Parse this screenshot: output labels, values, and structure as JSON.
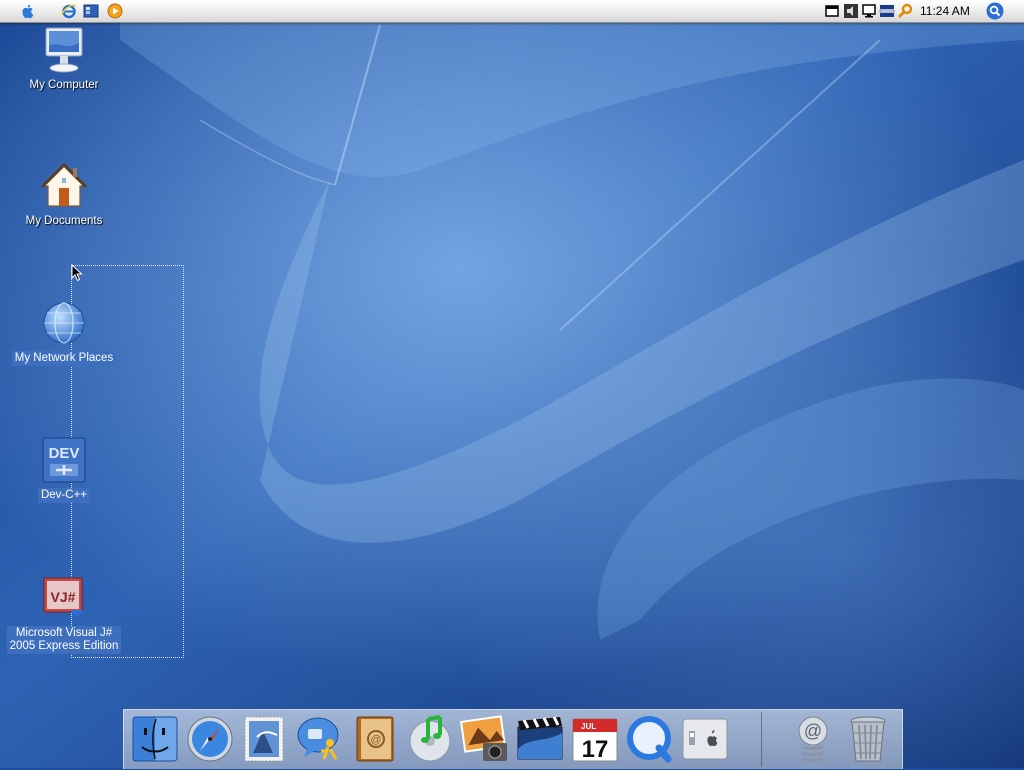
{
  "menubar": {
    "left_icons": [
      "apple-icon",
      "internet-explorer-icon",
      "show-desktop-icon",
      "media-player-icon"
    ],
    "tray_icons": [
      "window-icon",
      "volume-icon",
      "network-icon",
      "keyboard-icon",
      "search-key-icon"
    ],
    "clock": "11:24 AM",
    "spotlight_icon": "spotlight-icon"
  },
  "desktop": {
    "icons": [
      {
        "label": "My Computer",
        "icon": "computer-icon",
        "selected": false
      },
      {
        "label": "My Documents",
        "icon": "home-icon",
        "selected": false
      },
      {
        "label": "My Network Places",
        "icon": "globe-icon",
        "selected": true
      },
      {
        "label": "Dev-C++",
        "icon": "dev-cpp-icon",
        "selected": true
      },
      {
        "label_line1": "Microsoft Visual J#",
        "label_line2": "2005 Express Edition",
        "icon": "visual-jsharp-icon",
        "selected": true
      }
    ]
  },
  "dock": {
    "items": [
      "finder-icon",
      "safari-icon",
      "mail-stamp-icon",
      "ichat-icon",
      "address-book-icon",
      "itunes-icon",
      "iphoto-icon",
      "imovie-icon",
      "ical-icon",
      "quicktime-icon",
      "system-preferences-icon",
      "mail-at-icon",
      "trash-icon"
    ],
    "ical_month": "JUL",
    "ical_day": "17",
    "dev_text": "DEV",
    "vj_text": "VJ#"
  },
  "colors": {
    "wallpaper_dark": "#123a86",
    "wallpaper_light": "#5f93d6",
    "selection": "#3e6fbf"
  }
}
